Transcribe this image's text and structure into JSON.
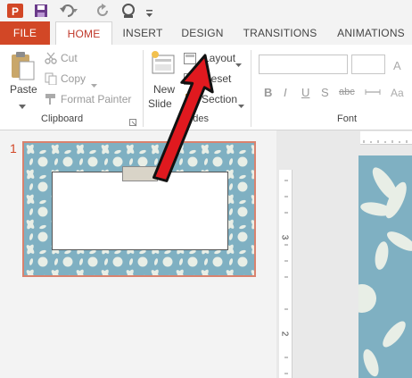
{
  "ribbon_tabs": {
    "file": "FILE",
    "home": "HOME",
    "insert": "INSERT",
    "design": "DESIGN",
    "transitions": "TRANSITIONS",
    "animations": "ANIMATIONS"
  },
  "clipboard": {
    "paste": "Paste",
    "cut": "Cut",
    "copy": "Copy",
    "format_painter": "Format Painter",
    "group_label": "Clipboard"
  },
  "slides_group": {
    "new_slide_line1": "New",
    "new_slide_line2": "Slide",
    "layout": "Layout",
    "reset": "Reset",
    "section": "Section",
    "group_label": "Slides"
  },
  "font_group": {
    "bold": "B",
    "italic": "I",
    "underline": "U",
    "shadow": "S",
    "strikethrough": "abc",
    "group_label": "Font"
  },
  "slide_panel": {
    "slide_number": "1"
  },
  "ruler": {
    "mark_3": "3",
    "mark_2": "2"
  },
  "colors": {
    "file_tab": "#d24726",
    "active_tab_text": "#c0392b",
    "slide_bg": "#7fb0c2",
    "selection_border": "#d9826e",
    "arrow": "#e0191f"
  }
}
